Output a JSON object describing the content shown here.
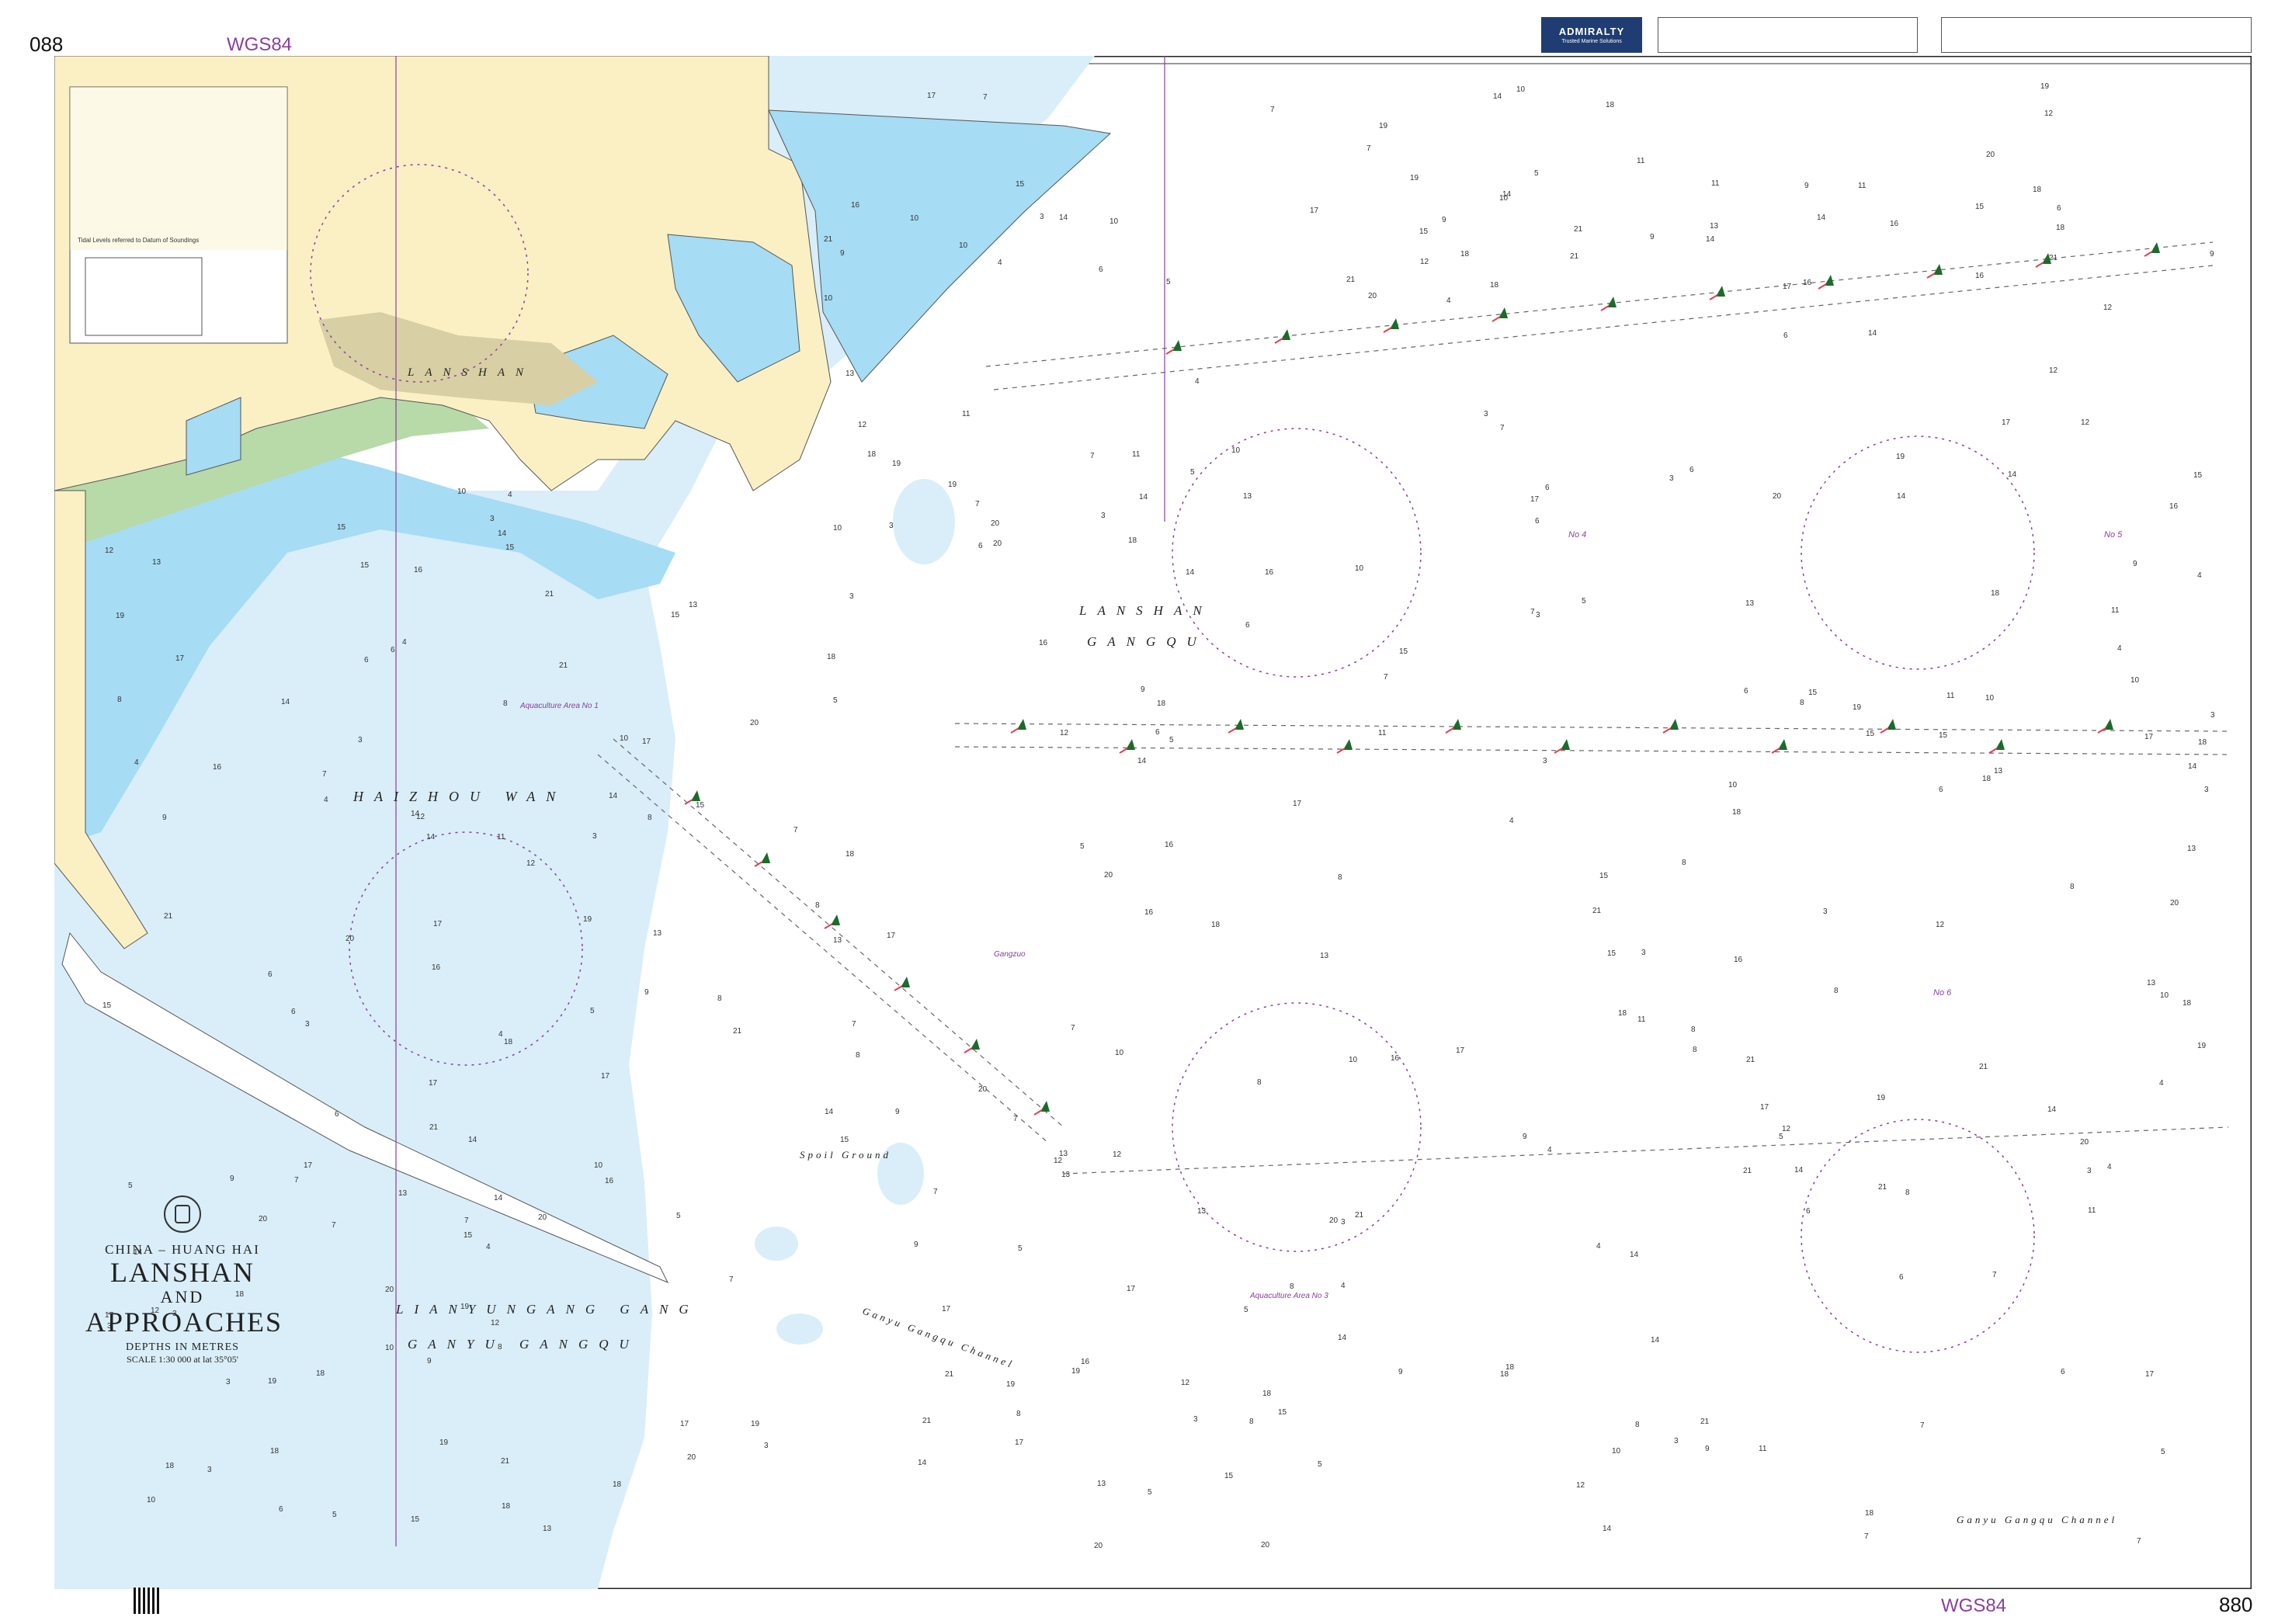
{
  "chart_number": "088",
  "chart_number_right": "880",
  "datum": "WGS84",
  "publisher": {
    "name": "ADMIRALTY",
    "tagline": "Trusted Marine Solutions"
  },
  "title": {
    "region": "CHINA – HUANG HAI",
    "main_line1": "LANSHAN",
    "main_line2": "AND",
    "main_line3": "APPROACHES",
    "depths": "DEPTHS IN METRES",
    "scale": "SCALE 1:30 000 at lat 35°05'"
  },
  "place_names": {
    "lanshan_town": "LANSHAN",
    "lanshan_gangqu": [
      "LANSHAN",
      "GANGQU"
    ],
    "haizhou_wan": "HAIZHOU WAN",
    "lianyungang_gang": "LIANYUNGANG GANG",
    "ganyu_gangqu": "GANYU GANGQU",
    "spoil_ground": "Spoil Ground",
    "ganyu_channel_1": "Ganyu Gangqu Channel",
    "ganyu_channel_2": "Ganyu Gangqu Channel"
  },
  "annotations": {
    "aquaculture_1": "Aquaculture Area No 1",
    "aquaculture_3": "Aquaculture Area No 3",
    "anch_4": "No 4",
    "anch_5": "No 5",
    "anch_6": "No 6",
    "gangzuo": "Gangzuo"
  },
  "inset": {
    "tide_note": "Tidal Levels referred to Datum of Soundings"
  },
  "colors": {
    "land": "#fbf0c4",
    "built_up": "#d9cfa4",
    "intertidal": "#b8d9a8",
    "shallow_water": "#a6dcf4",
    "mid_water": "#d9eef9",
    "deep_water": "#ffffff",
    "magenta": "#8a3fa0",
    "light_flare": "#e04050"
  },
  "soundings": [
    "14",
    "15",
    "16",
    "17",
    "18",
    "12",
    "13",
    "11",
    "9",
    "10",
    "8",
    "19",
    "20",
    "21",
    "7",
    "6",
    "5",
    "4",
    "3"
  ]
}
